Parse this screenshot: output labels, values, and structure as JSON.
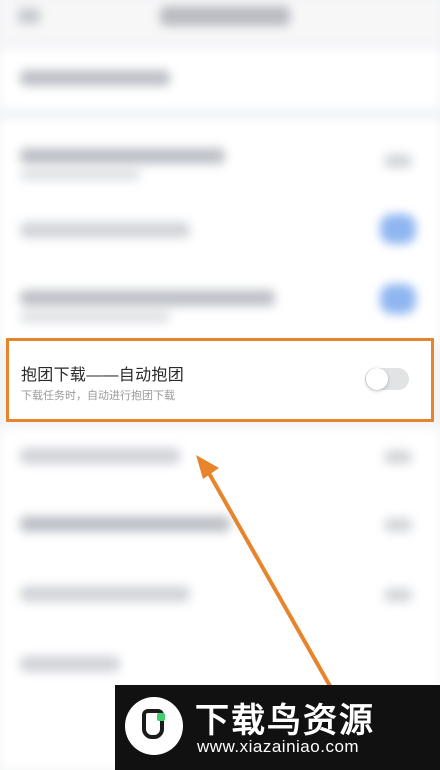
{
  "settings_row": {
    "title": "抱团下载——自动抱团",
    "subtitle": "下载任务时，自动进行抱团下载",
    "toggle_on": false
  },
  "colors": {
    "highlight": "#e8842c",
    "arrow": "#e8842c",
    "toggle_off_track": "#e2e3e5",
    "blurred_toggle_on": "#8fb6f0"
  },
  "watermark": {
    "title": "下载鸟资源",
    "url": "www.xiazainiao.com",
    "logo_icon": "bird-logo-icon"
  }
}
